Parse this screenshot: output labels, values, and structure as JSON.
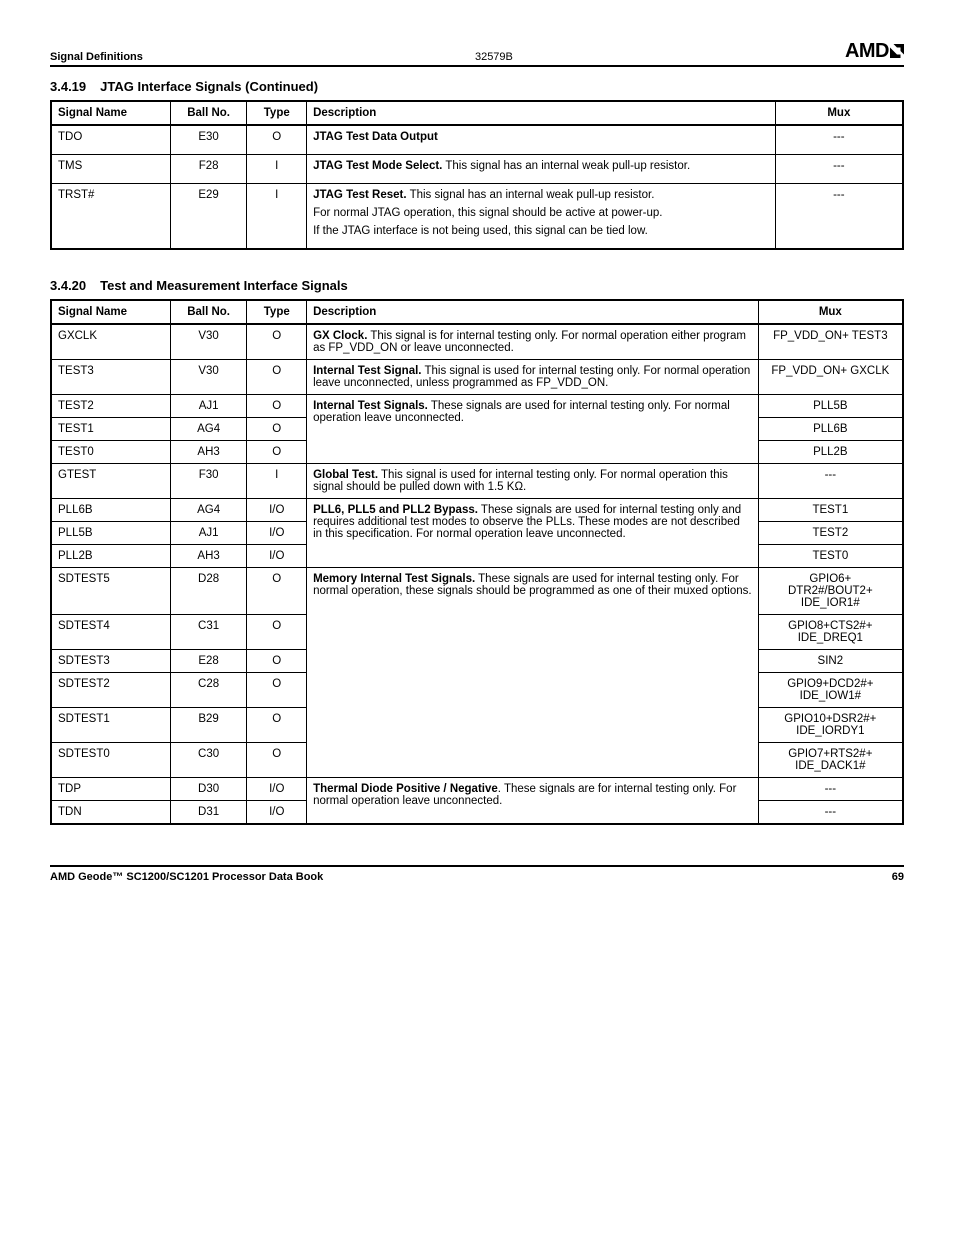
{
  "header": {
    "left": "Signal Definitions",
    "code": "32579B",
    "logo": "AMD"
  },
  "section1": {
    "num": "3.4.19",
    "title": "JTAG Interface Signals  (Continued)",
    "columns": [
      "Signal Name",
      "Ball No.",
      "Type",
      "Description",
      "Mux"
    ],
    "rows": [
      {
        "name": "TDO",
        "ball": "E30",
        "type": "O",
        "desc": [
          {
            "bold": "JTAG Test Data Output",
            "rest": ""
          }
        ],
        "mux": "---"
      },
      {
        "name": "TMS",
        "ball": "F28",
        "type": "I",
        "desc": [
          {
            "bold": "JTAG Test Mode Select.",
            "rest": " This signal has an internal weak pull-up resistor."
          }
        ],
        "mux": "---"
      },
      {
        "name": "TRST#",
        "ball": "E29",
        "type": "I",
        "desc": [
          {
            "bold": "JTAG Test Reset.",
            "rest": " This signal has an internal weak pull-up resistor."
          },
          {
            "bold": "",
            "rest": "For normal JTAG operation, this signal should be active at power-up."
          },
          {
            "bold": "",
            "rest": "If the JTAG interface is not being used, this signal can be tied low."
          }
        ],
        "mux": "---"
      }
    ]
  },
  "section2": {
    "num": "3.4.20",
    "title": "Test and Measurement Interface Signals",
    "columns": [
      "Signal Name",
      "Ball No.",
      "Type",
      "Description",
      "Mux"
    ],
    "group1": {
      "rows": [
        {
          "name": "GXCLK",
          "ball": "V30",
          "type": "O",
          "mux": "FP_VDD_ON+ TEST3"
        },
        {
          "name": "TEST3",
          "ball": "V30",
          "type": "O",
          "mux": "FP_VDD_ON+ GXCLK"
        }
      ],
      "descs": [
        {
          "bold": "GX Clock.",
          "rest": " This signal is for internal testing only. For normal operation either program as FP_VDD_ON or leave unconnected."
        },
        {
          "bold": "Internal Test Signal.",
          "rest": " This signal is used for internal testing only. For normal operation leave unconnected, unless programmed as FP_VDD_ON."
        }
      ]
    },
    "group2": {
      "rows": [
        {
          "name": "TEST2",
          "ball": "AJ1",
          "type": "O",
          "mux": "PLL5B"
        },
        {
          "name": "TEST1",
          "ball": "AG4",
          "type": "O",
          "mux": "PLL6B"
        },
        {
          "name": "TEST0",
          "ball": "AH3",
          "type": "O",
          "mux": "PLL2B"
        }
      ],
      "desc": {
        "bold": "Internal Test Signals.",
        "rest": " These signals are used for internal testing only. For normal operation leave unconnected."
      }
    },
    "gtest": {
      "name": "GTEST",
      "ball": "F30",
      "type": "I",
      "desc": {
        "bold": "Global Test.",
        "rest": " This signal is used for internal testing only. For normal operation this signal should be pulled down with 1.5 KΩ."
      },
      "mux": "---"
    },
    "group3": {
      "rows": [
        {
          "name": "PLL6B",
          "ball": "AG4",
          "type": "I/O",
          "mux": "TEST1"
        },
        {
          "name": "PLL5B",
          "ball": "AJ1",
          "type": "I/O",
          "mux": "TEST2"
        },
        {
          "name": "PLL2B",
          "ball": "AH3",
          "type": "I/O",
          "mux": "TEST0"
        }
      ],
      "desc": {
        "bold": "PLL6, PLL5 and PLL2 Bypass.",
        "rest": " These signals are used for internal testing only and requires additional test modes to observe the PLLs. These modes are not described in this specification. For normal operation leave unconnected."
      }
    },
    "group4": {
      "rows": [
        {
          "name": "SDTEST5",
          "ball": "D28",
          "type": "O",
          "mux": "GPIO6+\nDTR2#/BOUT2+\nIDE_IOR1#"
        },
        {
          "name": "SDTEST4",
          "ball": "C31",
          "type": "O",
          "mux": "GPIO8+CTS2#+\nIDE_DREQ1"
        },
        {
          "name": "SDTEST3",
          "ball": "E28",
          "type": "O",
          "mux": "SIN2"
        },
        {
          "name": "SDTEST2",
          "ball": "C28",
          "type": "O",
          "mux": "GPIO9+DCD2#+\nIDE_IOW1#"
        },
        {
          "name": "SDTEST1",
          "ball": "B29",
          "type": "O",
          "mux": "GPIO10+DSR2#+\nIDE_IORDY1"
        },
        {
          "name": "SDTEST0",
          "ball": "C30",
          "type": "O",
          "mux": "GPIO7+RTS2#+\nIDE_DACK1#"
        }
      ],
      "desc": {
        "bold": "Memory Internal Test Signals.",
        "rest": " These signals are used for internal testing only. For normal operation, these signals should be programmed as one of their muxed options."
      }
    },
    "group5": {
      "rows": [
        {
          "name": "TDP",
          "ball": "D30",
          "type": "I/O",
          "mux": "---"
        },
        {
          "name": "TDN",
          "ball": "D31",
          "type": "I/O",
          "mux": "---"
        }
      ],
      "desc": {
        "bold": "Thermal Diode Positive / Negative",
        "rest": ". These signals are for internal testing only. For normal operation leave unconnected."
      }
    }
  },
  "footer": {
    "left": "AMD Geode™ SC1200/SC1201 Processor Data Book",
    "right": "69"
  }
}
